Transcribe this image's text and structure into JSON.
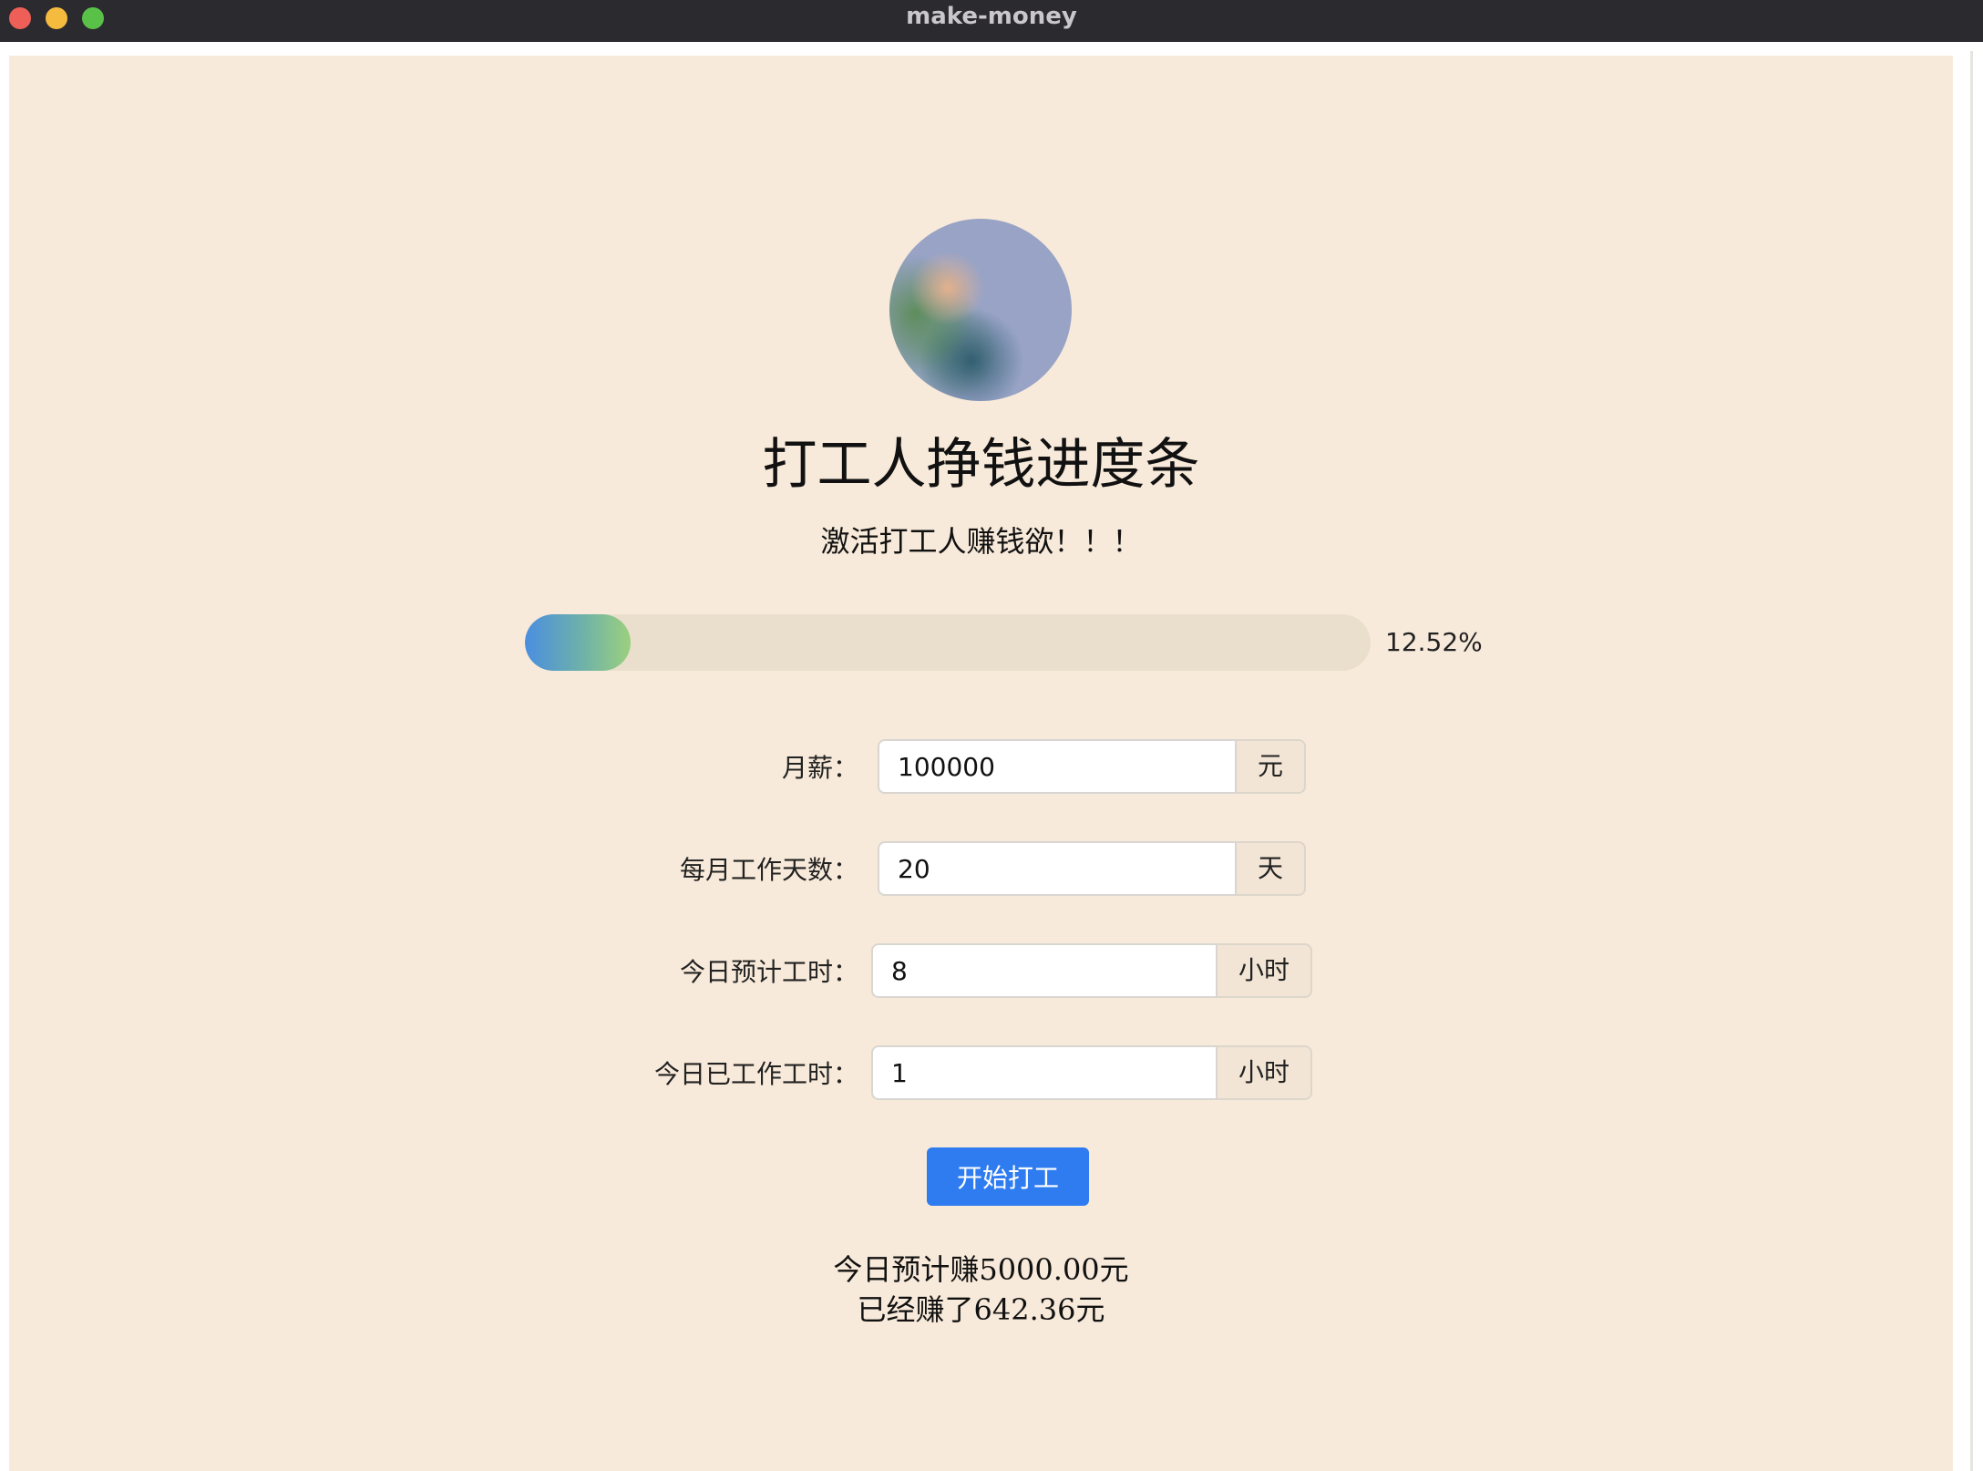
{
  "window": {
    "title": "make-money"
  },
  "header": {
    "title": "打工人挣钱进度条",
    "subtitle": "激活打工人赚钱欲！！！"
  },
  "progress": {
    "percent": 12.52,
    "label": "12.52%",
    "colors": [
      "#4a8ee0",
      "#9bd07e"
    ]
  },
  "form": {
    "monthly_salary": {
      "label": "月薪：",
      "value": "100000",
      "unit": "元"
    },
    "work_days": {
      "label": "每月工作天数：",
      "value": "20",
      "unit": "天"
    },
    "planned_hours": {
      "label": "今日预计工时：",
      "value": "8",
      "unit": "小时"
    },
    "worked_hours": {
      "label": "今日已工作工时：",
      "value": "1",
      "unit": "小时"
    }
  },
  "actions": {
    "start_label": "开始打工"
  },
  "result": {
    "expected_line": "今日预计赚5000.00元",
    "earned_line": "已经赚了642.36元"
  },
  "theme": {
    "background": "#f8eada",
    "accent": "#2f7cf0"
  }
}
